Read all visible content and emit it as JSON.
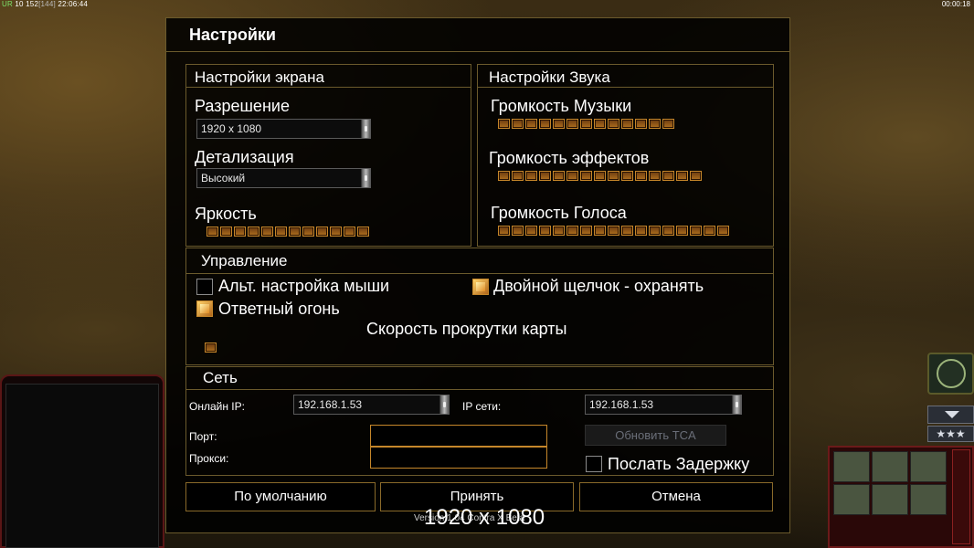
{
  "hud": {
    "left_prefix": "UR",
    "left_a": "10",
    "left_b": "152",
    "left_c": "[144]",
    "left_time": "22:06:44",
    "right_time": "00:00:18"
  },
  "dialog": {
    "title": "Настройки",
    "screen": {
      "title": "Настройки экрана",
      "resolution_label": "Разрешение",
      "resolution_value": "1920 x 1080",
      "detail_label": "Детализация",
      "detail_value": "Высокий",
      "brightness_label": "Яркость",
      "brightness_level": 12
    },
    "sound": {
      "title": "Настройки Звука",
      "music_label": "Громкость Музыки",
      "music_level": 13,
      "effects_label": "Громкость эффектов",
      "effects_level": 15,
      "voice_label": "Громкость Голоса",
      "voice_level": 17
    },
    "control": {
      "title": "Управление",
      "alt_mouse_label": "Альт. настройка мыши",
      "alt_mouse_checked": false,
      "double_click_label": "Двойной щелчок - охранять",
      "double_click_checked": true,
      "return_fire_label": "Ответный огонь",
      "return_fire_checked": true,
      "scroll_speed_label": "Скорость прокрутки карты",
      "scroll_speed_level": 1
    },
    "network": {
      "title": "Сеть",
      "online_ip_label": "Онлайн IP:",
      "online_ip_value": "192.168.1.53",
      "lan_ip_label": "IP сети:",
      "lan_ip_value": "192.168.1.53",
      "port_label": "Порт:",
      "proxy_label": "Прокси:",
      "port_value": "",
      "proxy_value": "",
      "update_button": "Обновить TCA",
      "send_delay_label": "Послать Задержку",
      "send_delay_checked": false
    },
    "buttons": {
      "default": "По умолчанию",
      "accept": "Принять",
      "cancel": "Отмена"
    }
  },
  "overlay": {
    "resolution_text": "1920 x 1080",
    "version_text": "Version 1.04 Contra X Beta"
  },
  "colors": {
    "accent": "#c5862a",
    "border": "#6b5a2c",
    "disabled_text": "#6a6e78"
  }
}
